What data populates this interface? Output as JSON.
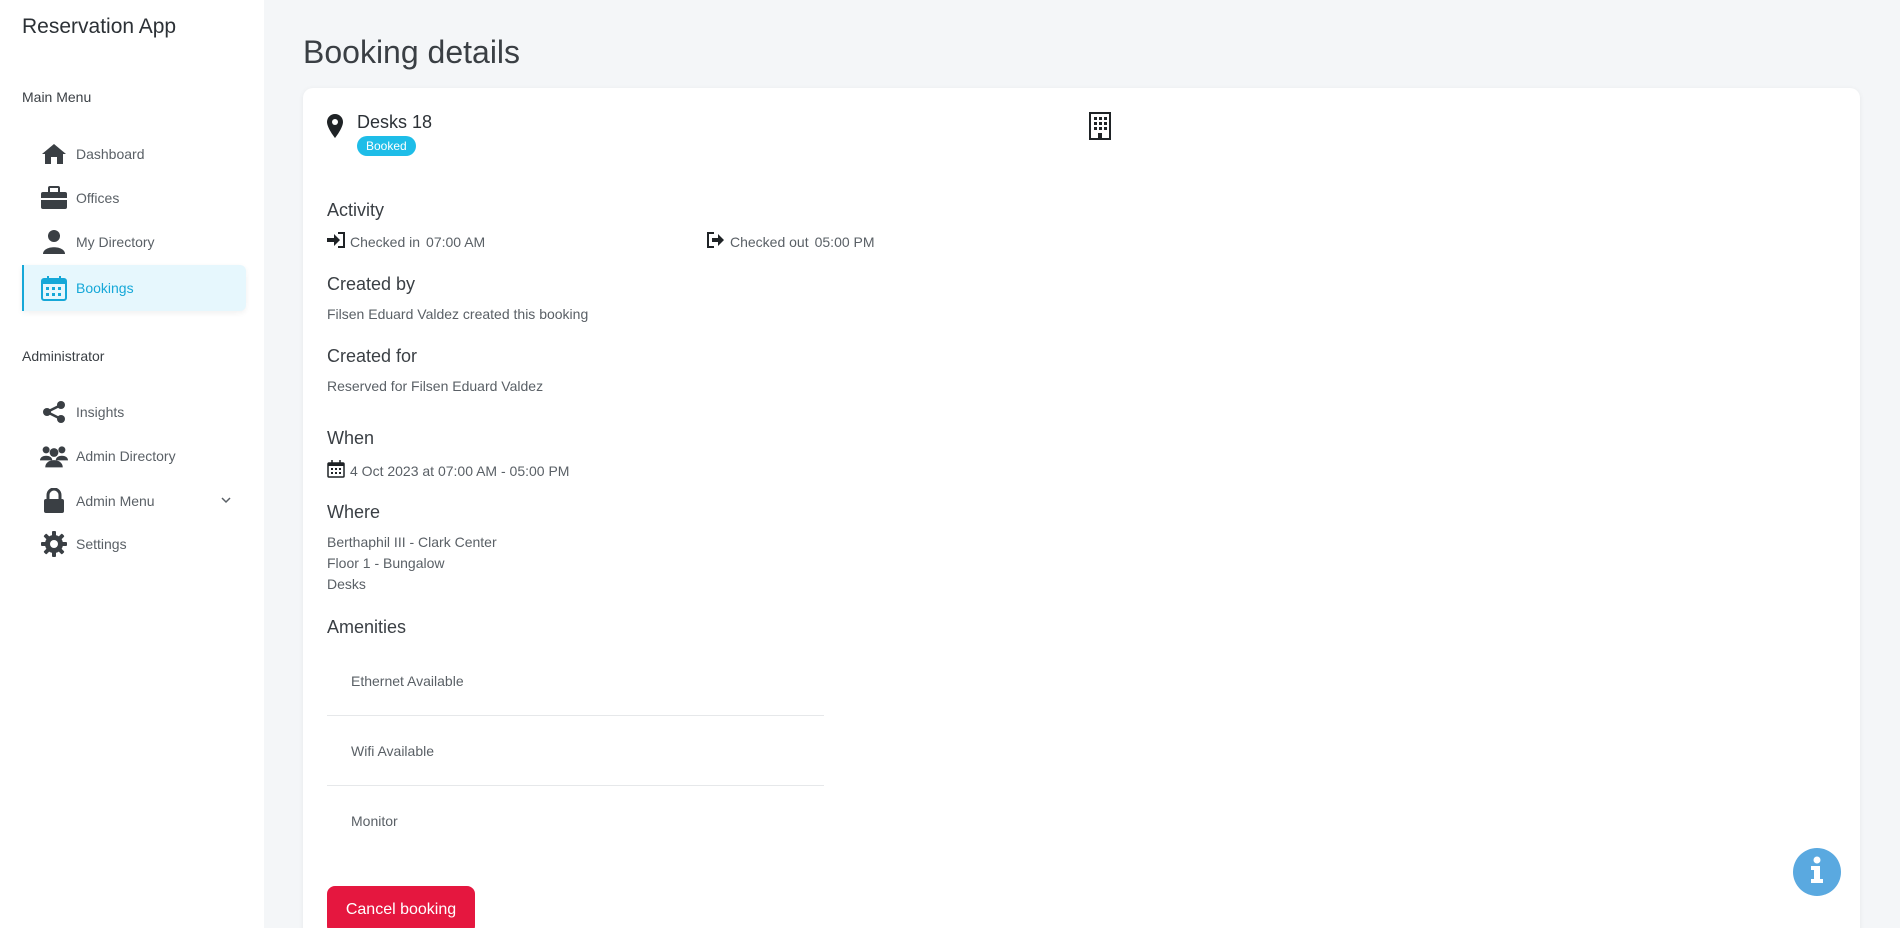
{
  "app": {
    "title": "Reservation App"
  },
  "sidebar": {
    "main_menu_label": "Main Menu",
    "main_items": [
      {
        "label": "Dashboard",
        "icon": "home-icon"
      },
      {
        "label": "Offices",
        "icon": "briefcase-icon"
      },
      {
        "label": "My Directory",
        "icon": "user-icon"
      },
      {
        "label": "Bookings",
        "icon": "calendar-icon",
        "active": true
      }
    ],
    "admin_label": "Administrator",
    "admin_items": [
      {
        "label": "Insights",
        "icon": "share-icon"
      },
      {
        "label": "Admin Directory",
        "icon": "users-icon"
      },
      {
        "label": "Admin Menu",
        "icon": "lock-icon"
      },
      {
        "label": "Settings",
        "icon": "gear-icon"
      }
    ]
  },
  "page": {
    "title": "Booking details"
  },
  "booking": {
    "location_name": "Desks 18",
    "status": "Booked",
    "activity": {
      "title": "Activity",
      "checked_in_label": "Checked in",
      "checked_in_time": "07:00 AM",
      "checked_out_label": "Checked out",
      "checked_out_time": "05:00 PM"
    },
    "created_by": {
      "title": "Created by",
      "text": "Filsen Eduard Valdez created this booking"
    },
    "created_for": {
      "title": "Created for",
      "text": "Reserved for Filsen Eduard Valdez"
    },
    "when": {
      "title": "When",
      "text": "4 Oct 2023 at 07:00 AM - 05:00 PM"
    },
    "where": {
      "title": "Where",
      "lines": [
        "Berthaphil III - Clark Center",
        "Floor 1 - Bungalow",
        "Desks"
      ]
    },
    "amenities": {
      "title": "Amenities",
      "items": [
        "Ethernet Available",
        "Wifi Available",
        "Monitor"
      ]
    },
    "cancel_label": "Cancel booking"
  },
  "colors": {
    "accent": "#16a8d8",
    "badge": "#1ebde8",
    "danger": "#e5173f",
    "info": "#5aa9e0"
  }
}
